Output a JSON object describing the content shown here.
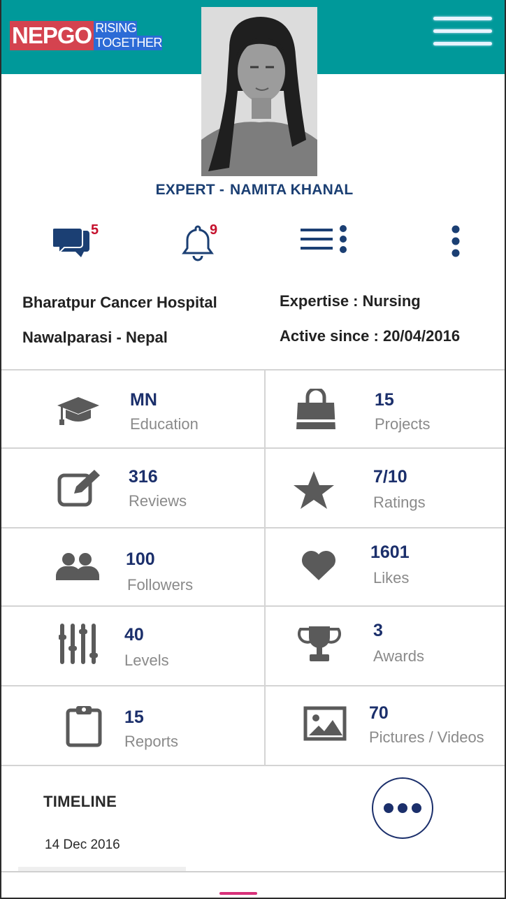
{
  "brand": {
    "logo": "NEPGO",
    "tagline_1": "RISING",
    "tagline_2": "TOGETHER"
  },
  "colors": {
    "header": "#00999a",
    "logo_red": "#d4434f",
    "logo_blue": "#2c6bd6",
    "navy": "#1b2f6b",
    "badge_red": "#c5102c",
    "label_gray": "#8a8a8a"
  },
  "header": {
    "menu_icon": "hamburger-menu-icon"
  },
  "profile": {
    "role": "EXPERT -",
    "name": "NAMITA KHANAL"
  },
  "actions": {
    "messages_icon": "chat-bubbles-icon",
    "messages_count": "5",
    "notifications_icon": "bell-icon",
    "notifications_count": "9",
    "list_icon": "list-options-icon",
    "more_icon": "vertical-dots-icon"
  },
  "info": {
    "hospital": "Bharatpur Cancer Hospital",
    "location": "Nawalparasi - Nepal",
    "expertise": "Expertise : Nursing",
    "active_since": "Active since : 20/04/2016"
  },
  "stats": [
    {
      "icon": "graduation-cap-icon",
      "value": "MN",
      "label": "Education"
    },
    {
      "icon": "shopping-bag-icon",
      "value": "15",
      "label": "Projects"
    },
    {
      "icon": "edit-pencil-icon",
      "value": "316",
      "label": "Reviews"
    },
    {
      "icon": "star-icon",
      "value": "7/10",
      "label": "Ratings"
    },
    {
      "icon": "users-icon",
      "value": "100",
      "label": "Followers"
    },
    {
      "icon": "heart-icon",
      "value": "1601",
      "label": "Likes"
    },
    {
      "icon": "sliders-icon",
      "value": "40",
      "label": "Levels"
    },
    {
      "icon": "trophy-icon",
      "value": "3",
      "label": "Awards"
    },
    {
      "icon": "clipboard-icon",
      "value": "15",
      "label": "Reports"
    },
    {
      "icon": "image-icon",
      "value": "70",
      "label": "Pictures / Videos"
    }
  ],
  "timeline": {
    "title": "TIMELINE",
    "date": "14 Dec 2016",
    "more_icon": "horizontal-dots-icon"
  }
}
